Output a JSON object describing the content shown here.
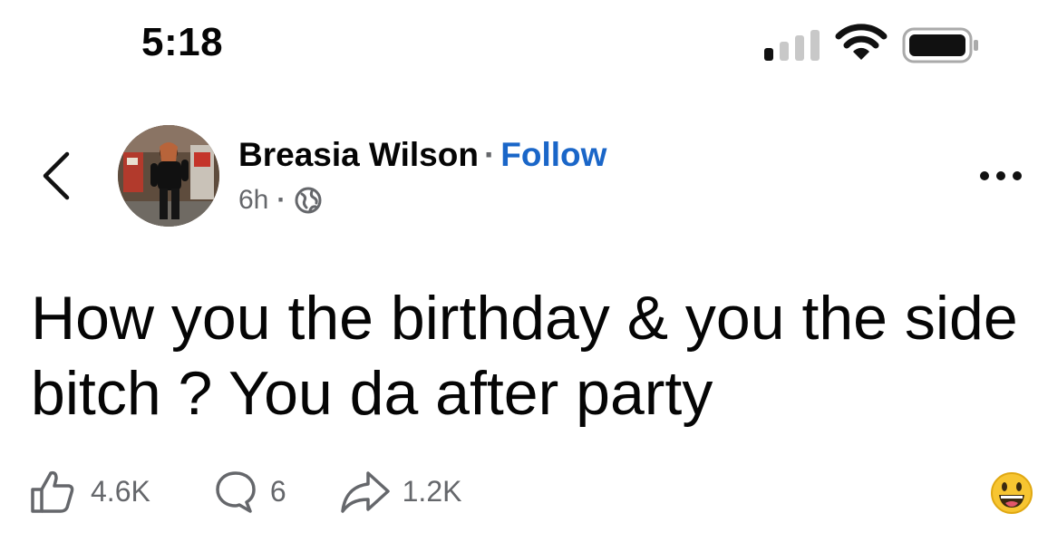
{
  "status_bar": {
    "time": "5:18",
    "icons": [
      "cellular-signal-icon",
      "wifi-icon",
      "battery-icon"
    ]
  },
  "post": {
    "author": "Breasia Wilson",
    "separator": "·",
    "follow_label": "Follow",
    "age": "6h",
    "meta_separator": "·",
    "audience_icon": "globe-icon",
    "text": "How you the birthday & you the side bitch ? You da after party"
  },
  "actions": {
    "likes": "4.6K",
    "comments": "6",
    "shares": "1.2K"
  },
  "colors": {
    "follow": "#1a66c8",
    "secondary_text": "#65676b",
    "primary_text": "#050505"
  }
}
